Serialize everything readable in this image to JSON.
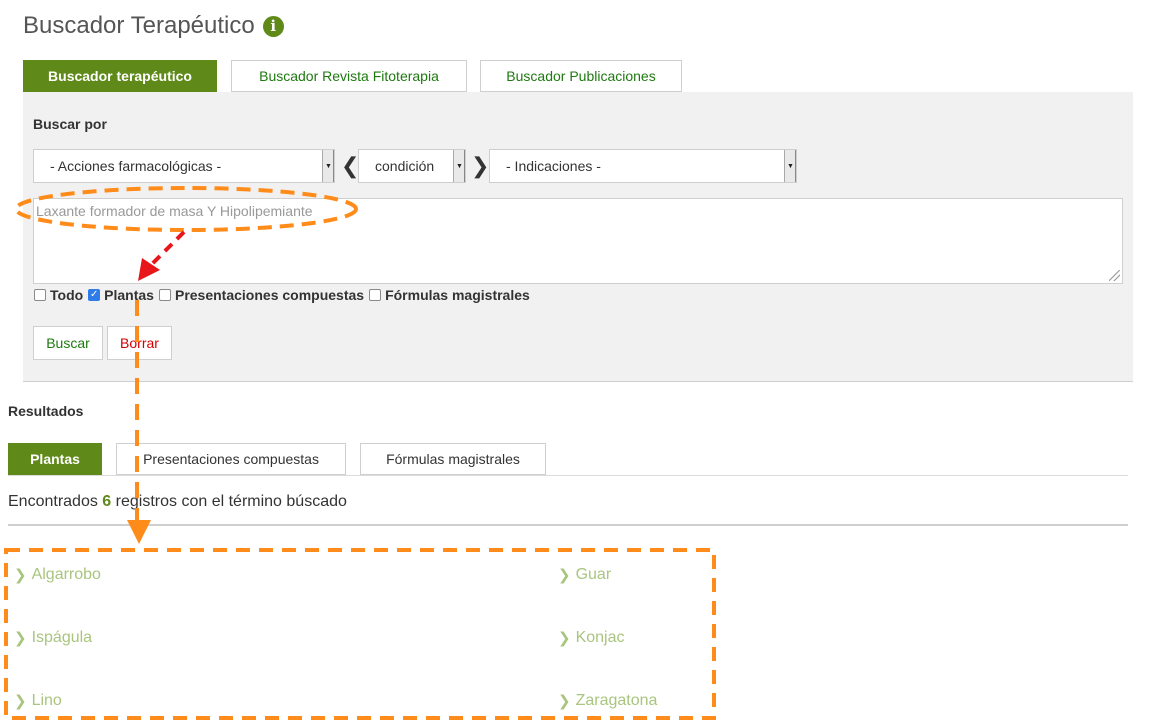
{
  "header": {
    "title": "Buscador Terapéutico",
    "info_glyph": "i"
  },
  "top_tabs": [
    {
      "label": "Buscador terapéutico",
      "active": true
    },
    {
      "label": "Buscador Revista Fitoterapia",
      "active": false
    },
    {
      "label": "Buscador Publicaciones",
      "active": false
    }
  ],
  "search": {
    "section_label": "Buscar por",
    "select_actions": "- Acciones farmacológicas -",
    "select_condition": "condición",
    "select_indications": "- Indicaciones -",
    "chevron_left": "❮",
    "chevron_right": "❯",
    "textarea_value": "Laxante formador de masa Y Hipolipemiante",
    "filters": [
      {
        "label": "Todo",
        "checked": false
      },
      {
        "label": "Plantas",
        "checked": true
      },
      {
        "label": "Presentaciones compuestas",
        "checked": false
      },
      {
        "label": "Fórmulas magistrales",
        "checked": false
      }
    ],
    "search_button": "Buscar",
    "clear_button": "Borrar"
  },
  "results": {
    "section_label": "Resultados",
    "tabs": [
      {
        "label": "Plantas",
        "active": true
      },
      {
        "label": "Presentaciones compuestas",
        "active": false
      },
      {
        "label": "Fórmulas magistrales",
        "active": false
      }
    ],
    "found_prefix": "Encontrados",
    "found_count": "6",
    "found_suffix": "registros con el término búscado",
    "items": [
      "Algarrobo",
      "Guar",
      "Ispágula",
      "Konjac",
      "Lino",
      "Zaragatona"
    ]
  },
  "colors": {
    "brand_green": "#5f8a19",
    "link_green": "#1e7a10",
    "result_green": "#a9c57f",
    "clear_red": "#d40000",
    "annotation_orange": "#ff8c1a",
    "annotation_red": "#e8161b"
  },
  "icons": {
    "info": "info-icon",
    "result_arrow": "chevron-right-icon",
    "select_arrow": "dropdown-arrow-icon"
  }
}
